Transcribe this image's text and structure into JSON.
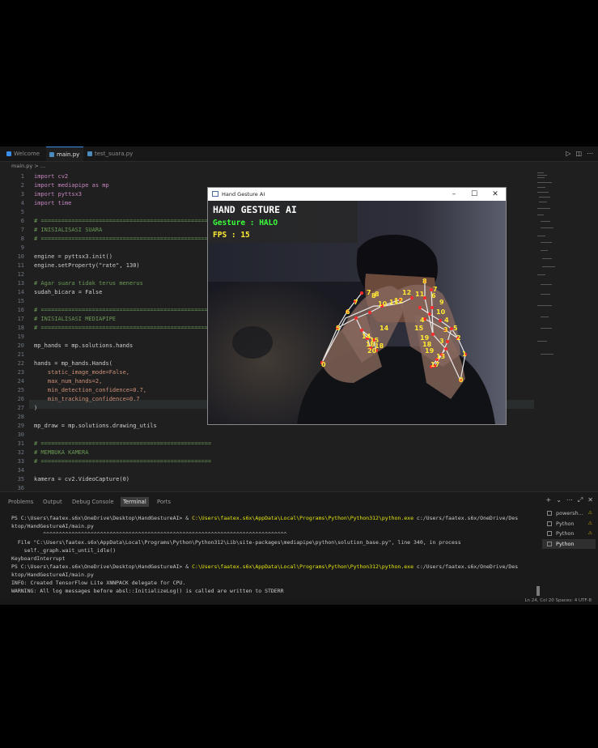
{
  "editor_tabs": [
    {
      "label": "Welcome",
      "icon": "vscode-icon"
    },
    {
      "label": "main.py",
      "icon": "python-icon"
    },
    {
      "label": "test_suara.py",
      "icon": "python-icon"
    }
  ],
  "breadcrumb": "main.py > ...",
  "code_lines": [
    {
      "n": "1",
      "text": "import cv2",
      "cls": "kw"
    },
    {
      "n": "2",
      "text": "import mediapipe as mp",
      "cls": "kw"
    },
    {
      "n": "3",
      "text": "import pyttsx3",
      "cls": "kw"
    },
    {
      "n": "4",
      "text": "import time",
      "cls": "kw"
    },
    {
      "n": "5",
      "text": "",
      "cls": ""
    },
    {
      "n": "6",
      "text": "# ==================================================",
      "cls": "cm"
    },
    {
      "n": "7",
      "text": "# INISIALISASI SUARA",
      "cls": "cm"
    },
    {
      "n": "8",
      "text": "# ==================================================",
      "cls": "cm"
    },
    {
      "n": "9",
      "text": "",
      "cls": ""
    },
    {
      "n": "10",
      "text": "engine = pyttsx3.init()",
      "cls": ""
    },
    {
      "n": "11",
      "text": "engine.setProperty(\"rate\", 130)",
      "cls": ""
    },
    {
      "n": "12",
      "text": "",
      "cls": ""
    },
    {
      "n": "13",
      "text": "# Agar suara tidak terus menerus",
      "cls": "cm"
    },
    {
      "n": "14",
      "text": "sudah_bicara = False",
      "cls": ""
    },
    {
      "n": "15",
      "text": "",
      "cls": ""
    },
    {
      "n": "16",
      "text": "# ==================================================",
      "cls": "cm"
    },
    {
      "n": "17",
      "text": "# INISIALISASI MEDIAPIPE",
      "cls": "cm"
    },
    {
      "n": "18",
      "text": "# ==================================================",
      "cls": "cm"
    },
    {
      "n": "19",
      "text": "",
      "cls": ""
    },
    {
      "n": "20",
      "text": "mp_hands = mp.solutions.hands",
      "cls": ""
    },
    {
      "n": "21",
      "text": "",
      "cls": ""
    },
    {
      "n": "22",
      "text": "hands = mp_hands.Hands(",
      "cls": ""
    },
    {
      "n": "23",
      "text": "    static_image_mode=False,",
      "cls": "pm"
    },
    {
      "n": "24",
      "text": "    max_num_hands=2,",
      "cls": "pm"
    },
    {
      "n": "25",
      "text": "    min_detection_confidence=0.7,",
      "cls": "pm"
    },
    {
      "n": "26",
      "text": "    min_tracking_confidence=0.7",
      "cls": "pm"
    },
    {
      "n": "27",
      "text": ")",
      "cls": ""
    },
    {
      "n": "28",
      "text": "",
      "cls": ""
    },
    {
      "n": "29",
      "text": "mp_draw = mp.solutions.drawing_utils",
      "cls": ""
    },
    {
      "n": "30",
      "text": "",
      "cls": ""
    },
    {
      "n": "31",
      "text": "# ==================================================",
      "cls": "cm"
    },
    {
      "n": "32",
      "text": "# MEMBUKA KAMERA",
      "cls": "cm"
    },
    {
      "n": "33",
      "text": "# ==================================================",
      "cls": "cm"
    },
    {
      "n": "34",
      "text": "",
      "cls": ""
    },
    {
      "n": "35",
      "text": "kamera = cv2.VideoCapture(0)",
      "cls": ""
    },
    {
      "n": "36",
      "text": "",
      "cls": ""
    }
  ],
  "hand_window": {
    "title": "Hand Gesture AI",
    "overlay_title": "HAND GESTURE AI",
    "gesture_text": "Gesture : HALO",
    "fps_text": "FPS : 15"
  },
  "panel_tabs": [
    "Problems",
    "Output",
    "Debug Console",
    "Terminal",
    "Ports"
  ],
  "terminal_lines": [
    {
      "prompt": "PS C:\\Users\\faatex.s6x\\OneDrive\\Desktop\\HandGestureAI> & ",
      "cmd": "C:\\Users\\faatex.s6x\\AppData\\Local\\Programs\\Python\\Python312\\python.exe",
      "rest": " c:/Users/faatex.s6x/OneDrive/Des"
    },
    {
      "prompt": "ktop/HandGestureAI/main.py",
      "cmd": "",
      "rest": ""
    },
    {
      "prompt": "          ^^^^^^^^^^^^^^^^^^^^^^^^^^^^^^^^^^^^^^^^^^^^^^^^^^^^^^^^^^^^^^^^^^^^^^^^^^^^^",
      "cmd": "",
      "rest": ""
    },
    {
      "prompt": "  File \"C:\\Users\\faatex.s6x\\AppData\\Local\\Programs\\Python\\Python312\\Lib\\site-packages\\mediapipe\\python\\solution_base.py\", line 340, in process",
      "cmd": "",
      "rest": ""
    },
    {
      "prompt": "    self._graph.wait_until_idle()",
      "cmd": "",
      "rest": ""
    },
    {
      "prompt": "KeyboardInterrupt",
      "cmd": "",
      "rest": ""
    },
    {
      "prompt": "PS C:\\Users\\faatex.s6x\\OneDrive\\Desktop\\HandGestureAI> & ",
      "cmd": "C:\\Users\\faatex.s6x\\AppData\\Local\\Programs\\Python\\Python312\\python.exe",
      "rest": " c:/Users/faatex.s6x/OneDrive/Des"
    },
    {
      "prompt": "ktop/HandGestureAI/main.py",
      "cmd": "",
      "rest": ""
    },
    {
      "prompt": "INFO: Created TensorFlow Lite XNNPACK delegate for CPU.",
      "cmd": "",
      "rest": ""
    },
    {
      "prompt": "WARNING: All log messages before absl::InitializeLog() is called are written to STDERR",
      "cmd": "",
      "rest": ""
    }
  ],
  "terminal_list": [
    {
      "label": "powersh...",
      "warn": true,
      "active": false
    },
    {
      "label": "Python",
      "warn": true,
      "active": false
    },
    {
      "label": "Python",
      "warn": true,
      "active": false
    },
    {
      "label": "Python",
      "warn": false,
      "active": true
    }
  ],
  "status_right": "Ln 24, Col 20   Spaces: 4   UTF-8"
}
